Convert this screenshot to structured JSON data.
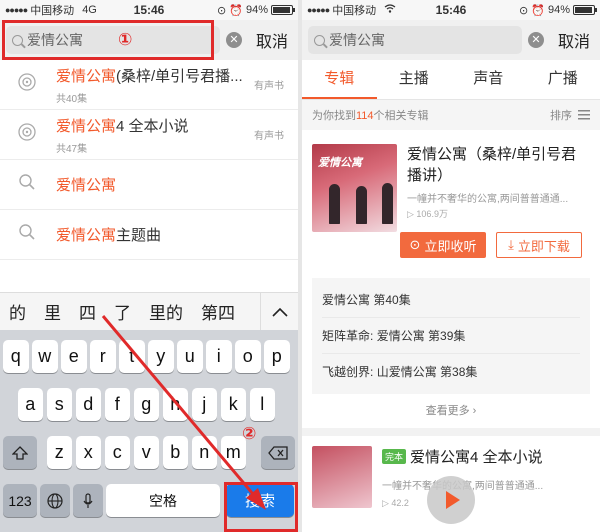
{
  "status": {
    "dots": "●●●●●",
    "carrier": "中国移动",
    "network_left": "4G",
    "time": "15:46",
    "battery": "94%",
    "battery_fill": 0.94
  },
  "search": {
    "query": "爱情公寓",
    "cancel_label": "取消"
  },
  "annotations": {
    "step1": "①",
    "step2": "②",
    "color": "#e02a2a"
  },
  "suggestions": [
    {
      "type": "album",
      "highlight": "爱情公寓",
      "rest": "(桑梓/单引号君播...",
      "sub": "共40集",
      "tag": "有声书"
    },
    {
      "type": "album",
      "highlight": "爱情公寓",
      "rest": "4 全本小说",
      "sub": "共47集",
      "tag": "有声书"
    },
    {
      "type": "query",
      "highlight": "爱情公寓",
      "rest": ""
    },
    {
      "type": "query",
      "highlight": "爱情公寓",
      "rest": "主题曲"
    }
  ],
  "candidates": [
    "的",
    "里",
    "四",
    "了",
    "里的",
    "第四"
  ],
  "keyboard": {
    "row1": [
      "q",
      "w",
      "e",
      "r",
      "t",
      "y",
      "u",
      "i",
      "o",
      "p"
    ],
    "row2": [
      "a",
      "s",
      "d",
      "f",
      "g",
      "h",
      "j",
      "k",
      "l"
    ],
    "row3": [
      "z",
      "x",
      "c",
      "v",
      "b",
      "n",
      "m"
    ],
    "num_key": "123",
    "space_key": "空格",
    "search_key": "搜索"
  },
  "tabs": [
    "专辑",
    "主播",
    "声音",
    "广播"
  ],
  "results": {
    "prefix": "为你找到",
    "count": "114",
    "suffix": "个相关专辑",
    "sort_label": "排序"
  },
  "album1": {
    "cover_text": "爱情公寓",
    "title": "爱情公寓（桑梓/单引号君播讲）",
    "desc": "一幢并不奢华的公寓,两间普普通通...",
    "plays": "106.9万",
    "listen_label": "立即收听",
    "download_label": "立即下载"
  },
  "episodes": [
    {
      "show": "爱情公寓",
      "ep": "第40集"
    },
    {
      "show": "矩阵革命:",
      "ep": "爱情公寓 第39集"
    },
    {
      "show": "飞越创界:",
      "ep": "山爱情公寓 第38集"
    }
  ],
  "more_label": "查看更多",
  "album2": {
    "badge": "完本",
    "title": "爱情公寓4 全本小说",
    "desc": "一幢并不奢华的公寓,两间普普通通...",
    "plays": "42.2"
  },
  "colors": {
    "accent": "#f25a2c",
    "ios_blue": "#1a7bea"
  }
}
